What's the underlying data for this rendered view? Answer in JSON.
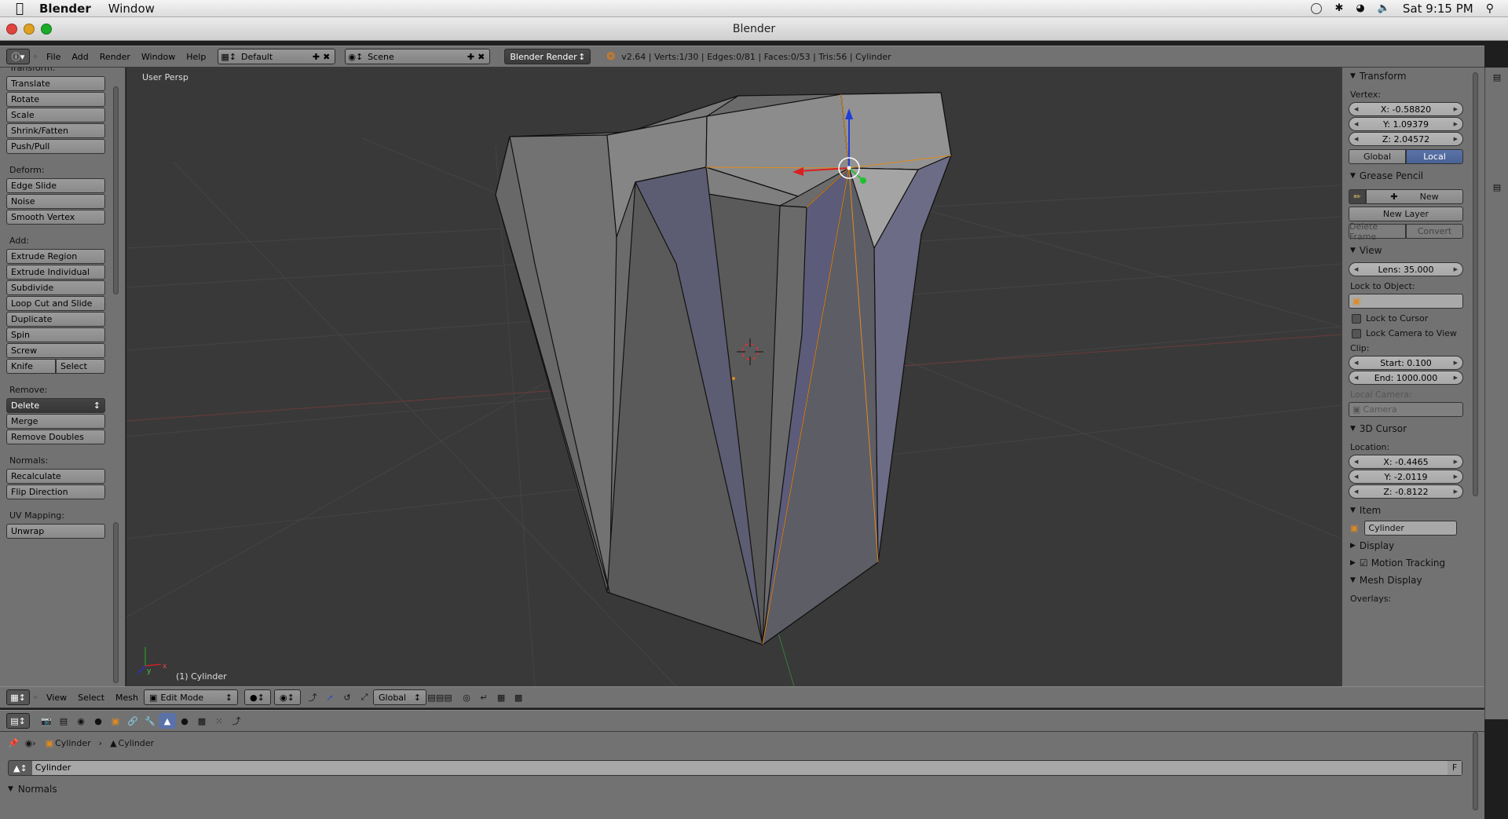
{
  "macbar": {
    "app": "Blender",
    "menus": [
      "Window"
    ],
    "clock": "Sat 9:15 PM"
  },
  "window": {
    "title": "Blender"
  },
  "info_header": {
    "menus": [
      "File",
      "Add",
      "Render",
      "Window",
      "Help"
    ],
    "screen_layout": "Default",
    "scene": "Scene",
    "engine": "Blender Render",
    "stats": "v2.64 | Verts:1/30 | Edges:0/81 | Faces:0/53 | Tris:56 | Cylinder"
  },
  "toolshelf": {
    "sections": [
      {
        "label": "Transform:",
        "buttons": [
          "Translate",
          "Rotate",
          "Scale",
          "Shrink/Fatten",
          "Push/Pull"
        ]
      },
      {
        "label": "Deform:",
        "buttons": [
          "Edge Slide",
          "Noise",
          "Smooth Vertex"
        ]
      },
      {
        "label": "Add:",
        "buttons": [
          "Extrude Region",
          "Extrude Individual",
          "Subdivide",
          "Loop Cut and Slide",
          "Duplicate",
          "Spin",
          "Screw"
        ],
        "pair": [
          "Knife",
          "Select"
        ]
      },
      {
        "label": "Remove:",
        "dropdown": "Delete",
        "buttons": [
          "Merge",
          "Remove Doubles"
        ]
      },
      {
        "label": "Normals:",
        "buttons": [
          "Recalculate",
          "Flip Direction"
        ]
      },
      {
        "label": "UV Mapping:",
        "buttons": [
          "Unwrap"
        ]
      }
    ]
  },
  "viewport": {
    "view_name": "User Persp",
    "object_label": "(1) Cylinder",
    "axis_x": "x",
    "axis_y": "y"
  },
  "npanel": {
    "transform": {
      "title": "Transform",
      "vertex_label": "Vertex:",
      "x": "X: -0.58820",
      "y": "Y: 1.09379",
      "z": "Z: 2.04572",
      "global": "Global",
      "local": "Local"
    },
    "grease": {
      "title": "Grease Pencil",
      "new": "New",
      "new_layer": "New Layer",
      "delete_frame": "Delete Frame",
      "convert": "Convert"
    },
    "view": {
      "title": "View",
      "lens": "Lens: 35.000",
      "lock_obj": "Lock to Object:",
      "lock_cursor": "Lock to Cursor",
      "lock_camera": "Lock Camera to View",
      "clip": "Clip:",
      "start": "Start: 0.100",
      "end": "End: 1000.000",
      "local_camera": "Local Camera:",
      "camera": "Camera"
    },
    "cursor": {
      "title": "3D Cursor",
      "location": "Location:",
      "x": "X: -0.4465",
      "y": "Y: -2.0119",
      "z": "Z: -0.8122"
    },
    "item": {
      "title": "Item",
      "name": "Cylinder"
    },
    "display": {
      "title": "Display"
    },
    "motion": {
      "title": "Motion Tracking"
    },
    "mesh_display": {
      "title": "Mesh Display",
      "overlays": "Overlays:"
    }
  },
  "view3d_header": {
    "menus": [
      "View",
      "Select",
      "Mesh"
    ],
    "mode": "Edit Mode",
    "orientation": "Global"
  },
  "props": {
    "crumb1": "Cylinder",
    "crumb2": "Cylinder",
    "datablock": "Cylinder",
    "fake": "F",
    "panel": "Normals"
  }
}
